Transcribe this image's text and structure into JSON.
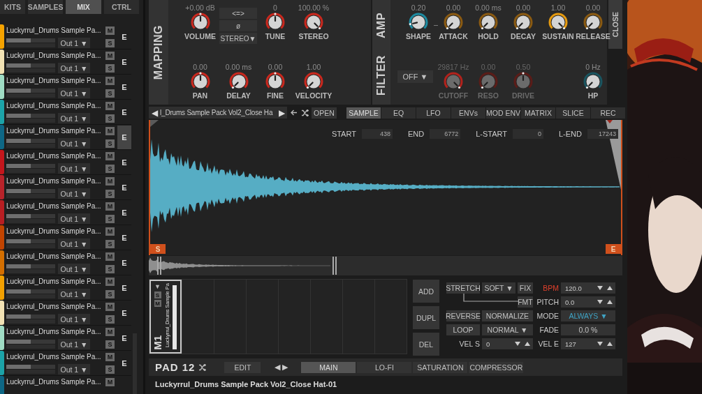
{
  "left_tabs": [
    {
      "label": "KITS",
      "selected": false
    },
    {
      "label": "SAMPLES",
      "selected": false
    },
    {
      "label": "MIX",
      "selected": true
    },
    {
      "label": "CTRL",
      "selected": false
    }
  ],
  "pads": [
    {
      "name": "Luckyrrul_Drums Sample Pa...",
      "color": "#f5a300",
      "level": 0.5,
      "output": "Out 1 ▼",
      "mute": "M",
      "solo": "S",
      "edit": "E",
      "selected": false
    },
    {
      "name": "Luckyrrul_Drums Sample Pa...",
      "color": "#f2e2b4",
      "level": 0.5,
      "output": "Out 1 ▼",
      "mute": "M",
      "solo": "S",
      "edit": "E",
      "selected": false
    },
    {
      "name": "Luckyrrul_Drums Sample Pa...",
      "color": "#9fdcc4",
      "level": 0.5,
      "output": "Out 1 ▼",
      "mute": "M",
      "solo": "S",
      "edit": "E",
      "selected": false
    },
    {
      "name": "Luckyrrul_Drums Sample Pa...",
      "color": "#1ca3a8",
      "level": 0.5,
      "output": "Out 1 ▼",
      "mute": "M",
      "solo": "S",
      "edit": "E",
      "selected": false
    },
    {
      "name": "Luckyrrul_Drums Sample Pa...",
      "color": "#0e6785",
      "level": 0.5,
      "output": "Out 1 ▼",
      "mute": "M",
      "solo": "S",
      "edit": "E",
      "selected": true
    },
    {
      "name": "Luckyrrul_Drums Sample Pa...",
      "color": "#c4161c",
      "level": 0.5,
      "output": "Out 1 ▼",
      "mute": "M",
      "solo": "S",
      "edit": "E",
      "selected": false
    },
    {
      "name": "Luckyrrul_Drums Sample Pa...",
      "color": "#b8232a",
      "level": 0.5,
      "output": "Out 1 ▼",
      "mute": "M",
      "solo": "S",
      "edit": "E",
      "selected": false
    },
    {
      "name": "Luckyrrul_Drums Sample Pa...",
      "color": "#b81e22",
      "level": 0.5,
      "output": "Out 1 ▼",
      "mute": "M",
      "solo": "S",
      "edit": "E",
      "selected": false
    },
    {
      "name": "Luckyrrul_Drums Sample Pa...",
      "color": "#c24400",
      "level": 0.5,
      "output": "Out 1 ▼",
      "mute": "M",
      "solo": "S",
      "edit": "E",
      "selected": false
    },
    {
      "name": "Luckyrrul_Drums Sample Pa...",
      "color": "#d46f00",
      "level": 0.5,
      "output": "Out 1 ▼",
      "mute": "M",
      "solo": "S",
      "edit": "E",
      "selected": false
    },
    {
      "name": "Luckyrrul_Drums Sample Pa...",
      "color": "#f2a000",
      "level": 0.5,
      "output": "Out 1 ▼",
      "mute": "M",
      "solo": "S",
      "edit": "E",
      "selected": false
    },
    {
      "name": "Luckyrrul_Drums Sample Pa...",
      "color": "#f2e2b4",
      "level": 0.5,
      "output": "Out 1 ▼",
      "mute": "M",
      "solo": "S",
      "edit": "E",
      "selected": false
    },
    {
      "name": "Luckyrrul_Drums Sample Pa...",
      "color": "#9fdcc4",
      "level": 0.5,
      "output": "Out 1 ▼",
      "mute": "M",
      "solo": "S",
      "edit": "E",
      "selected": false
    },
    {
      "name": "Luckyrrul_Drums Sample Pa...",
      "color": "#1ca3a8",
      "level": 0.5,
      "output": "Out 1 ▼",
      "mute": "M",
      "solo": "S",
      "edit": "E",
      "selected": false
    },
    {
      "name": "Luckyrrul_Drums Sample Pa...",
      "color": "#0e6785",
      "mute": "M"
    }
  ],
  "mapping": {
    "title": "MAPPING",
    "knobs": [
      {
        "value": "+0.00 dB",
        "label": "VOLUME",
        "level": 0.5,
        "color": "#c8281e",
        "disabled": false
      },
      {
        "value": "0",
        "label": "TUNE",
        "level": 0.5,
        "color": "#c8281e",
        "disabled": false
      },
      {
        "value": "100.00 %",
        "label": "STEREO",
        "level": 1,
        "color": "#c8281e",
        "disabled": false
      },
      {
        "value": "0.00",
        "label": "PAN",
        "level": 0.5,
        "color": "#c8281e",
        "disabled": false
      },
      {
        "value": "0.00 ms",
        "label": "DELAY",
        "level": 0,
        "color": "#c8281e",
        "disabled": false
      },
      {
        "value": "0.00",
        "label": "FINE",
        "level": 0.5,
        "color": "#c8281e",
        "disabled": false
      },
      {
        "value": "1.00",
        "label": "VELOCITY",
        "level": 0,
        "color": "#c8281e",
        "disabled": false
      }
    ],
    "buttons": [
      "<=>",
      "ø",
      "STEREO▼"
    ]
  },
  "amp": {
    "title": "AMP",
    "knobs": [
      {
        "value": "0.20",
        "label": "SHAPE",
        "level": 0.12,
        "color": "#1d8aa0",
        "disabled": false
      },
      {
        "value": "0.00",
        "label": "ATTACK",
        "level": 0,
        "color": "#8a5a12",
        "disabled": false
      },
      {
        "value": "0.00 ms",
        "label": "HOLD",
        "level": 0,
        "color": "#8a5a12",
        "disabled": false
      },
      {
        "value": "0.00",
        "label": "DECAY",
        "level": 0,
        "color": "#8a5a12",
        "disabled": false
      },
      {
        "value": "1.00",
        "label": "SUSTAIN",
        "level": 1,
        "color": "#e59a10",
        "disabled": false
      },
      {
        "value": "0.00",
        "label": "RELEASE",
        "level": 0,
        "color": "#8a5a12",
        "disabled": false
      }
    ]
  },
  "filter": {
    "title": "FILTER",
    "mode": "OFF ▼",
    "knobs": [
      {
        "value": "29817 Hz",
        "label": "CUTOFF",
        "level": 1,
        "color": "#b0221c",
        "disabled": true
      },
      {
        "value": "0.00",
        "label": "RESO",
        "level": 0,
        "color": "#5a1c18",
        "disabled": true
      },
      {
        "value": "0.50",
        "label": "DRIVE",
        "level": 0.5,
        "color": "#5a1c18",
        "disabled": true
      },
      {
        "value": "0 Hz",
        "label": "HP",
        "level": 0,
        "color": "#1a5560",
        "disabled": false
      }
    ]
  },
  "close": "CLOSE",
  "sample_nav": {
    "prev": "◀",
    "name": "l_Drums Sample Pack Vol2_Close Ha",
    "next": "▶",
    "open": "OPEN"
  },
  "editor_tabs": [
    {
      "label": "SAMPLE",
      "selected": true
    },
    {
      "label": "EQ",
      "selected": false
    },
    {
      "label": "LFO",
      "selected": false
    },
    {
      "label": "ENVs",
      "selected": false
    },
    {
      "label": "MOD ENV",
      "selected": false
    },
    {
      "label": "MATRIX",
      "selected": false
    },
    {
      "label": "SLICE",
      "selected": false
    },
    {
      "label": "REC",
      "selected": false
    }
  ],
  "range_fields": [
    {
      "label": "START",
      "value": "438"
    },
    {
      "label": "END",
      "value": "6772"
    },
    {
      "label": "L-START",
      "value": "0"
    },
    {
      "label": "L-END",
      "value": "17243"
    }
  ],
  "markers": {
    "start": "S",
    "end": "E"
  },
  "slots": [
    {
      "name": "M1",
      "sample": "Luckyrrul_Drums Sample Pa",
      "menu": "▼",
      "solo": "S",
      "mute": "M",
      "level": 1,
      "selected": true
    }
  ],
  "slot_actions": [
    "ADD",
    "DUPL",
    "DEL"
  ],
  "sample_controls": [
    {
      "kind": "button",
      "label": "STRETCH"
    },
    {
      "kind": "dropdown",
      "label": "SOFT ▼"
    },
    {
      "kind": "button",
      "label": "FIX"
    },
    {
      "kind": "label",
      "label": "BPM",
      "color": "#e0402c"
    },
    {
      "kind": "spinner",
      "value": "120.0"
    },
    {
      "kind": "button",
      "label": "FMT"
    },
    {
      "kind": "label",
      "label": "PITCH"
    },
    {
      "kind": "spinner",
      "value": "0.0"
    },
    {
      "kind": "button",
      "label": "REVERSE"
    },
    {
      "kind": "button",
      "label": "NORMALIZE"
    },
    {
      "kind": "label",
      "label": "MODE"
    },
    {
      "kind": "dropdown",
      "label": "ALWAYS ▼",
      "color": "#3fa3c4"
    },
    {
      "kind": "button",
      "label": "LOOP"
    },
    {
      "kind": "dropdown",
      "label": "NORMAL ▼"
    },
    {
      "kind": "label",
      "label": "FADE"
    },
    {
      "kind": "field",
      "value": "0.0 %"
    },
    {
      "kind": "label",
      "label": "VEL S"
    },
    {
      "kind": "spinner",
      "value": "0"
    },
    {
      "kind": "label",
      "label": "VEL E"
    },
    {
      "kind": "spinner",
      "value": "127"
    }
  ],
  "pad": {
    "title": "PAD 12",
    "edit": "EDIT",
    "prev": "◀",
    "next": "▶"
  },
  "fx_tabs": [
    {
      "label": "MAIN",
      "selected": true
    },
    {
      "label": "LO-FI",
      "selected": false
    },
    {
      "label": "SATURATION",
      "selected": false
    },
    {
      "label": "COMPRESSOR",
      "selected": false
    }
  ],
  "file_name": "Luckyrrul_Drums Sample Pack Vol2_Close Hat-01"
}
